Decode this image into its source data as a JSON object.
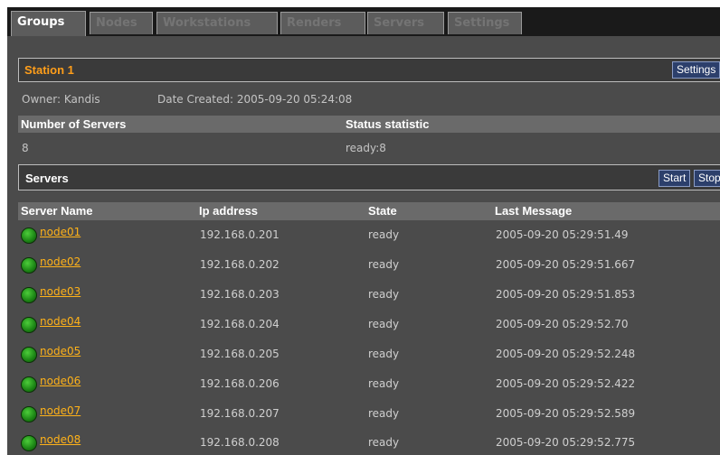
{
  "tabs": [
    {
      "label": "Groups",
      "active": true
    },
    {
      "label": "Nodes",
      "active": false
    },
    {
      "label": "Workstations",
      "active": false
    },
    {
      "label": "Renders",
      "active": false
    },
    {
      "label": "Servers",
      "active": false
    },
    {
      "label": "Settings",
      "active": false
    }
  ],
  "station": {
    "title": "Station 1",
    "settings_label": "Settings",
    "owner": "Owner: Kandis",
    "date_created": "Date Created: 2005-09-20 05:24:08"
  },
  "summary": {
    "headers": [
      "Number of Servers",
      "Status statistic"
    ],
    "values": [
      "8",
      "ready:8"
    ]
  },
  "servers_section": {
    "title": "Servers",
    "start_label": "Start",
    "stop_label": "Stop"
  },
  "table": {
    "headers": [
      "Server Name",
      "Ip address",
      "State",
      "Last Message"
    ],
    "rows": [
      {
        "name": "node01",
        "ip": "192.168.0.201",
        "state": "ready",
        "last": "2005-09-20 05:29:51.49"
      },
      {
        "name": "node02",
        "ip": "192.168.0.202",
        "state": "ready",
        "last": "2005-09-20 05:29:51.667"
      },
      {
        "name": "node03",
        "ip": "192.168.0.203",
        "state": "ready",
        "last": "2005-09-20 05:29:51.853"
      },
      {
        "name": "node04",
        "ip": "192.168.0.204",
        "state": "ready",
        "last": "2005-09-20 05:29:52.70"
      },
      {
        "name": "node05",
        "ip": "192.168.0.205",
        "state": "ready",
        "last": "2005-09-20 05:29:52.248"
      },
      {
        "name": "node06",
        "ip": "192.168.0.206",
        "state": "ready",
        "last": "2005-09-20 05:29:52.422"
      },
      {
        "name": "node07",
        "ip": "192.168.0.207",
        "state": "ready",
        "last": "2005-09-20 05:29:52.589"
      },
      {
        "name": "node08",
        "ip": "192.168.0.208",
        "state": "ready",
        "last": "2005-09-20 05:29:52.775"
      }
    ]
  },
  "colors": {
    "accent_orange": "#ff9e1a",
    "link_orange": "#ffb219",
    "status_green": "#2fa526",
    "button_blue": "#2c3f6b"
  },
  "icons": {
    "status": "green-status-light-icon"
  }
}
